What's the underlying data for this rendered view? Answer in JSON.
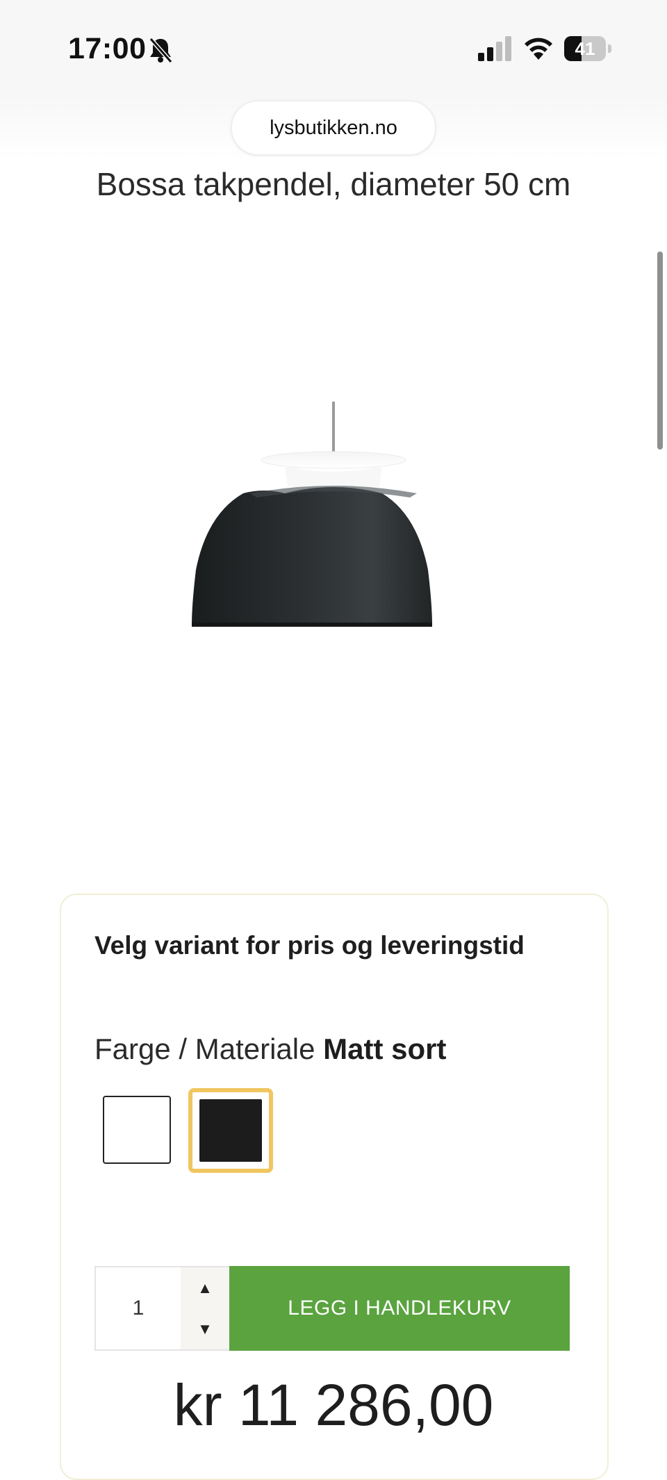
{
  "status_bar": {
    "time": "17:00",
    "battery_level": "41",
    "icons": [
      "bell-slash-icon",
      "cellular-signal-icon",
      "wifi-icon",
      "battery-icon"
    ]
  },
  "browser": {
    "url": "lysbutikken.no"
  },
  "product": {
    "title": "Bossa takpendel, diameter 50 cm",
    "image": "black-pendant-lamp"
  },
  "variant_card": {
    "heading": "Velg variant for pris og leveringstid",
    "color_label": "Farge / Materiale",
    "selected_color": "Matt sort",
    "swatches": [
      {
        "color": "#ffffff",
        "selected": false
      },
      {
        "color": "#1c1c1c",
        "selected": true
      }
    ],
    "accent_color": "#f0c660"
  },
  "purchase": {
    "quantity": "1",
    "add_to_cart_label": "LEGG I HANDLEKURV",
    "button_color": "#5aa33f",
    "price": "kr 11 286,00"
  }
}
